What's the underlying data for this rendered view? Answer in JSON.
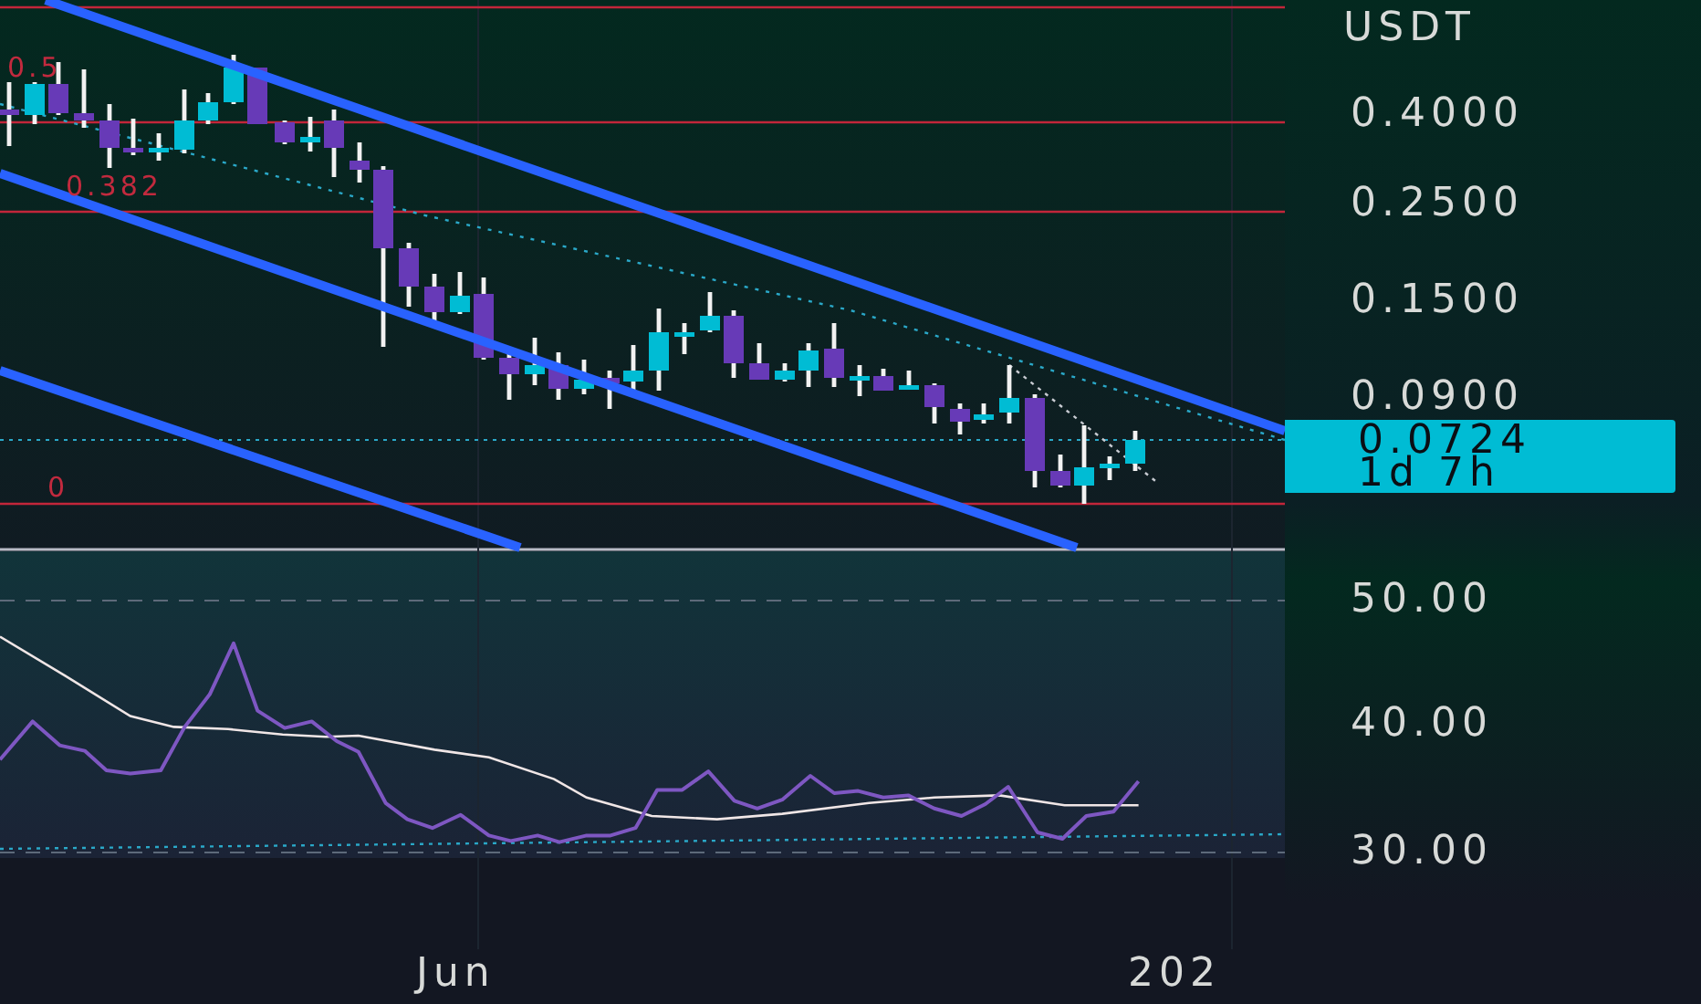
{
  "fib_levels": [
    {
      "label": "0.5"
    },
    {
      "label": "0.382"
    },
    {
      "label": "0"
    }
  ],
  "price_axis": {
    "currency": "USDT",
    "ticks": [
      "0.4000",
      "0.2500",
      "0.1500",
      "0.0900"
    ],
    "last_price": {
      "price": "0.0724",
      "countdown": "1d 7h"
    }
  },
  "rsi_axis": {
    "ticks": [
      "50.00",
      "40.00",
      "30.00"
    ]
  },
  "time_axis": {
    "labels": [
      "Jun",
      "202"
    ]
  }
}
